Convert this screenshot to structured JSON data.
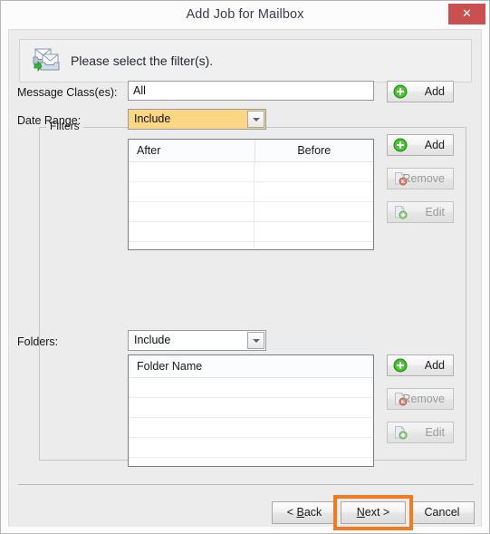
{
  "window": {
    "title": "Add Job for Mailbox",
    "close_label": "✕"
  },
  "header": {
    "icon": "mailbox-import-icon",
    "instruction": "Please select the filter(s)."
  },
  "filters": {
    "legend": "Filters",
    "message_class": {
      "label": "Message Class(es):",
      "value": "All",
      "add_label": "Add"
    },
    "date_range": {
      "label": "Date Range:",
      "mode": "Include",
      "highlight_color": "#fbd684",
      "columns": [
        "After",
        "Before"
      ],
      "rows": [],
      "empty_row_count": 5,
      "add_label": "Add",
      "remove_label": "Remove",
      "edit_label": "Edit"
    },
    "folders": {
      "label": "Folders:",
      "mode": "Include",
      "columns": [
        "Folder Name"
      ],
      "rows": [],
      "empty_row_count": 5,
      "add_label": "Add",
      "remove_label": "Remove",
      "edit_label": "Edit"
    }
  },
  "footer": {
    "back_label": "< Back",
    "next_prefix": "",
    "next_accel": "N",
    "next_suffix": "ext >",
    "back_accel": "B",
    "back_prefix": "< ",
    "back_suffix": "ack",
    "cancel_label": "Cancel"
  },
  "highlight": {
    "target": "next-button",
    "color": "#f07c1f"
  }
}
